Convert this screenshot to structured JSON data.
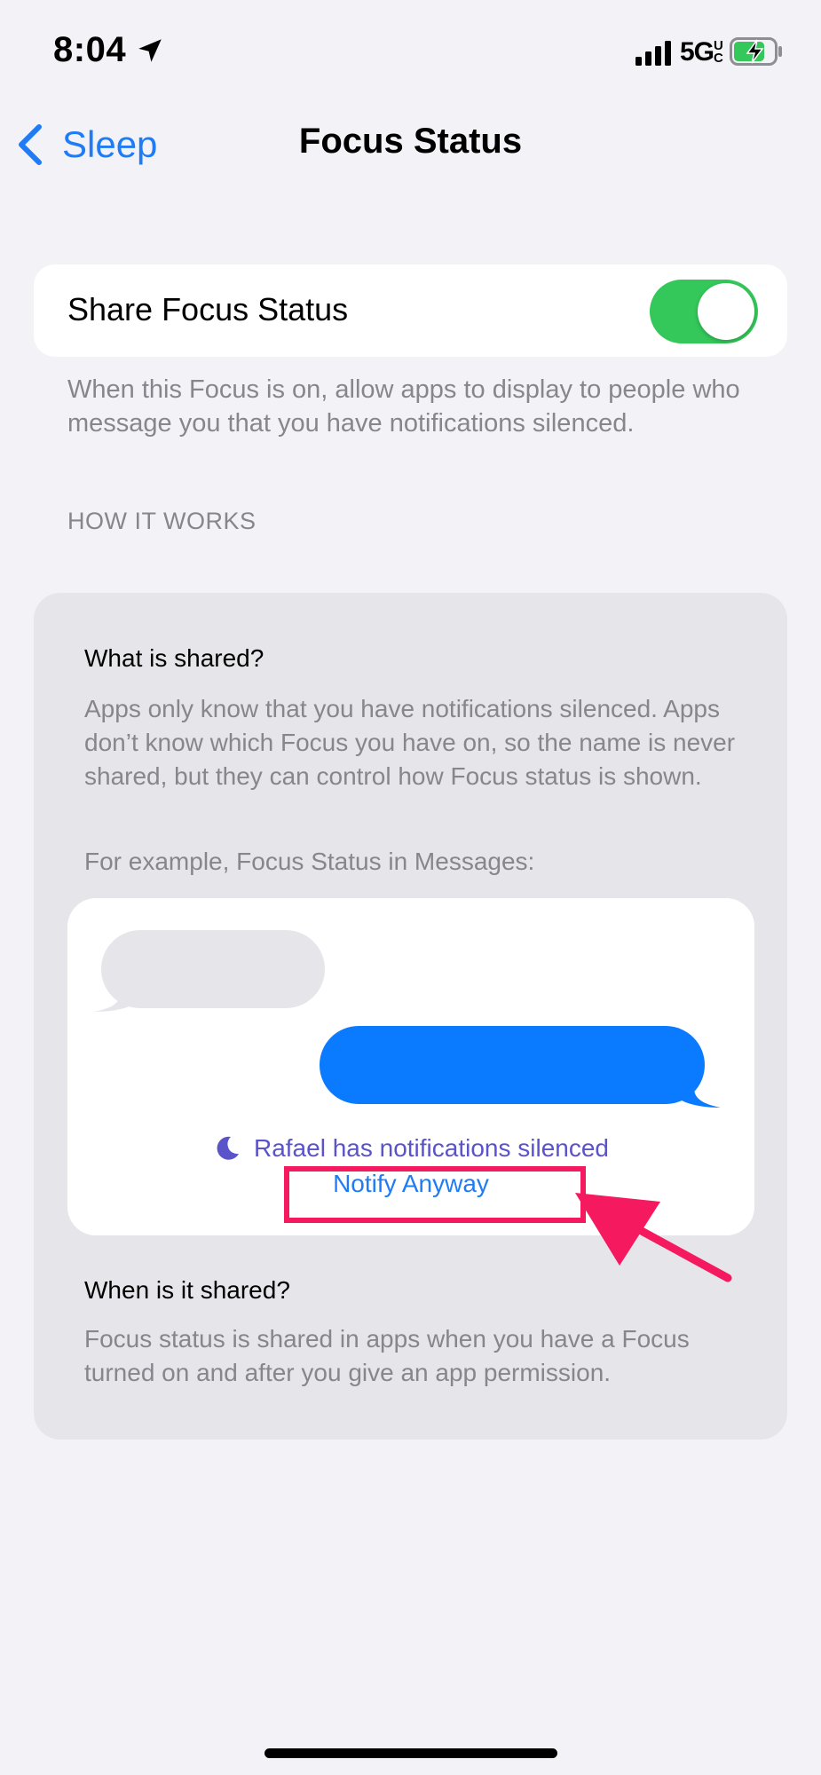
{
  "status_bar": {
    "time": "8:04",
    "network": "5G",
    "network_suffix": "UC",
    "icons": [
      "location-arrow-icon",
      "signal-bars-icon",
      "battery-charging-icon"
    ],
    "battery_color": "#34c759"
  },
  "nav": {
    "back_label": "Sleep",
    "title": "Focus Status",
    "accent_color": "#1f7cf5"
  },
  "share_toggle": {
    "label": "Share Focus Status",
    "state": "on",
    "on_color": "#34c759"
  },
  "share_description": "When this Focus is on, allow apps to display to people who message you that you have notifications silenced.",
  "section_header": "HOW IT WORKS",
  "how_it_works": {
    "what_heading": "What is shared?",
    "what_body": "Apps only know that you have notifications silenced. Apps don’t know which Focus you have on, so the name is never shared, but they can control how Focus status is shown.",
    "example_caption": "For example, Focus Status in Messages:",
    "preview": {
      "incoming_bubble_color": "#e5e5ea",
      "outgoing_bubble_color": "#0a7aff",
      "silenced_text": "Rafael has notifications silenced",
      "silenced_color": "#5b53c9",
      "notify_anyway": "Notify Anyway"
    },
    "when_heading": "When is it shared?",
    "when_body": "Focus status is shared in apps when you have a Focus turned on and after you give an app permission."
  },
  "annotation": {
    "color": "#f5195f",
    "target": "Notify Anyway"
  }
}
